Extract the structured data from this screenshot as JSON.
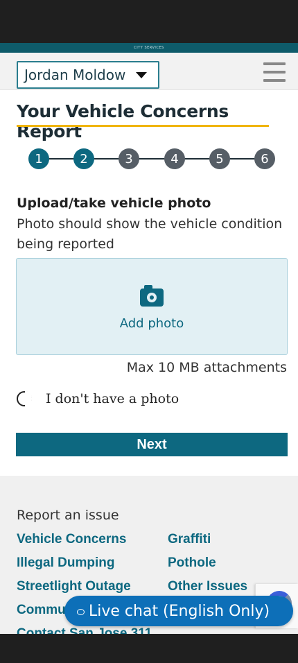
{
  "brand": "CITY SERVICES",
  "header": {
    "user_name": "Jordan Moldow",
    "menu_icon": "hamburger-menu-icon"
  },
  "page_title": "Your Vehicle Concerns Report",
  "steps": {
    "labels": [
      "1",
      "2",
      "3",
      "4",
      "5",
      "6"
    ],
    "current": 2,
    "active_color": "#0d6880",
    "inactive_color": "#565e66"
  },
  "upload": {
    "heading": "Upload/take vehicle photo",
    "description": "Photo should show the vehicle condition being reported",
    "add_label": "Add photo",
    "icon": "camera-icon",
    "max_note": "Max 10 MB attachments"
  },
  "no_photo_option": "I don't have a photo",
  "next_label": "Next",
  "footer": {
    "heading": "Report an issue",
    "links_left": [
      "Vehicle Concerns",
      "Illegal Dumping",
      "Streetlight Outage",
      "Commu",
      "Contact San Jose 311"
    ],
    "links_right": [
      "Graffiti",
      "Pothole",
      "Other Issues"
    ]
  },
  "live_chat": {
    "label": "Live chat (English Only)",
    "icon": "chat-bubble-icon"
  },
  "colors": {
    "accent": "#0d6880",
    "underline": "#f0b400",
    "chat": "#0d6fb8"
  }
}
